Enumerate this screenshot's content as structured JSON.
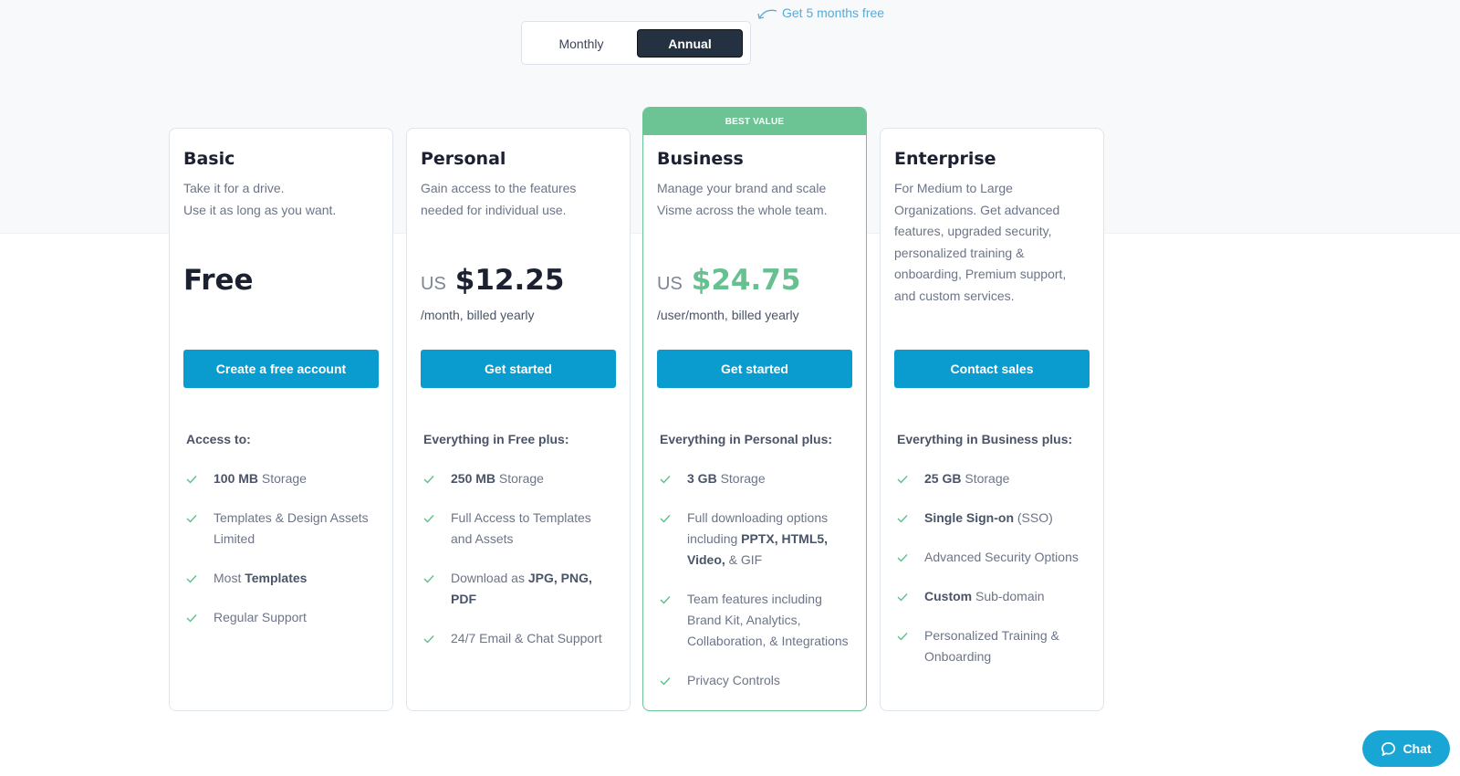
{
  "billing_toggle": {
    "options": [
      "Monthly",
      "Annual"
    ],
    "selected": "Annual",
    "promo": "Get 5 months free"
  },
  "colors": {
    "accent_blue": "#0b9ccf",
    "best_value_green": "#6cc495",
    "dark_toggle": "#243140"
  },
  "plans": [
    {
      "name": "Basic",
      "description_lines": [
        "Take it for a drive.",
        "Use it as long as you want."
      ],
      "price_text": "Free",
      "billing": "",
      "cta": "Create a free account",
      "includes_heading": "Access to:",
      "features": [
        {
          "bold": "100 MB",
          "text": " Storage"
        },
        {
          "bold": "",
          "text": "Templates & Design Assets Limited"
        },
        {
          "pre": "Most ",
          "bold": "Templates",
          "text": ""
        },
        {
          "bold": "",
          "text": "Regular Support"
        }
      ]
    },
    {
      "name": "Personal",
      "description": "Gain access to the features needed for individual use.",
      "currency": "US",
      "price": "$12.25",
      "billing": "/month, billed yearly",
      "cta": "Get started",
      "includes_heading": "Everything in Free plus:",
      "features": [
        {
          "bold": "250 MB",
          "text": " Storage"
        },
        {
          "bold": "",
          "text": "Full Access to Templates and Assets"
        },
        {
          "pre": "Download as ",
          "bold": "JPG, PNG, PDF",
          "text": ""
        },
        {
          "bold": "",
          "text": "24/7 Email & Chat Support"
        }
      ]
    },
    {
      "name": "Business",
      "badge": "BEST VALUE",
      "description": "Manage your brand and scale Visme across the whole team.",
      "currency": "US",
      "price": "$24.75",
      "billing": "/user/month, billed yearly",
      "cta": "Get started",
      "includes_heading": "Everything in Personal plus:",
      "features": [
        {
          "bold": "3 GB",
          "text": " Storage"
        },
        {
          "pre": "Full downloading options including ",
          "bold": "PPTX, HTML5, Video,",
          "text": " & GIF"
        },
        {
          "bold": "",
          "text": "Team features including Brand Kit, Analytics, Collaboration, & Integrations"
        },
        {
          "bold": "",
          "text": "Privacy Controls"
        }
      ]
    },
    {
      "name": "Enterprise",
      "description": "For Medium to Large Organizations. Get advanced features, upgraded security, personalized training & onboarding, Premium support, and custom services.",
      "cta": "Contact sales",
      "includes_heading": "Everything in Business plus:",
      "features": [
        {
          "bold": "25 GB",
          "text": " Storage"
        },
        {
          "bold": "Single Sign-on",
          "text": " (SSO)"
        },
        {
          "bold": "",
          "text": "Advanced Security Options"
        },
        {
          "bold": "Custom",
          "text": " Sub-domain"
        },
        {
          "bold": "",
          "text": "Personalized Training & Onboarding"
        }
      ]
    }
  ],
  "chat": {
    "label": "Chat",
    "icon": "chat-bubble-icon"
  }
}
